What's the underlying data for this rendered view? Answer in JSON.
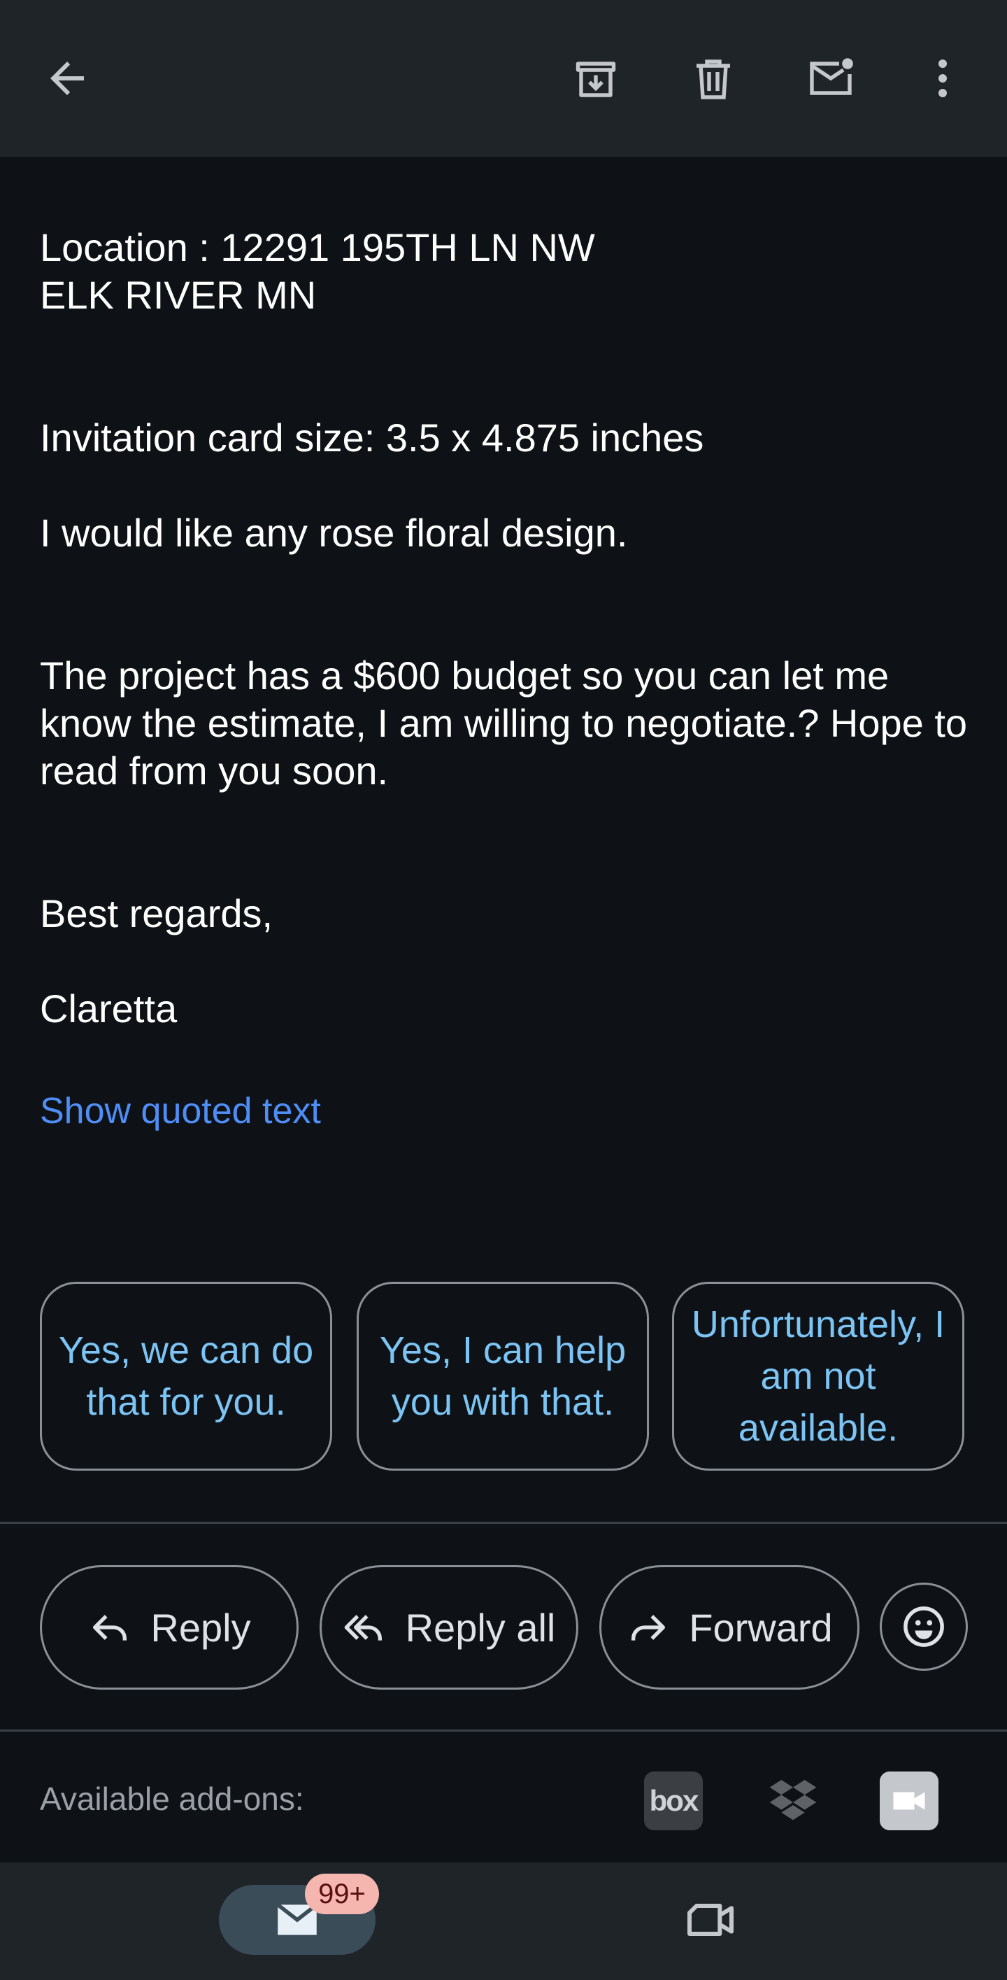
{
  "toolbar": {
    "back": "arrow-back-icon",
    "archive": "archive-icon",
    "delete": "trash-icon",
    "mark_unread": "mark-unread-icon",
    "more": "more-vert-icon"
  },
  "email": {
    "location": "Location : 12291 195TH LN NW\nELK RIVER  MN",
    "card_size": "Invitation card size: 3.5 x 4.875 inches",
    "design": "I would like any rose floral design.",
    "budget": "The project has a $600 budget so you can let me know the estimate, I am willing to negotiate.?  Hope to read from you soon.",
    "closing": "Best regards,",
    "signature": "Claretta",
    "show_quoted": "Show quoted text"
  },
  "smart_replies": [
    "Yes, we can do that for you.",
    "Yes, I can help you with that.",
    "Unfortunately, I am not available."
  ],
  "actions": {
    "reply": "Reply",
    "reply_all": "Reply all",
    "forward": "Forward"
  },
  "addons": {
    "label": "Available add-ons:",
    "box": "box"
  },
  "nav": {
    "mail_badge": "99+"
  },
  "colors": {
    "background": "#0e1216",
    "toolbar": "#1f2429",
    "link": "#4f8ef7",
    "smart_reply_text": "#7cc4f4",
    "badge": "#f6b6b0"
  }
}
